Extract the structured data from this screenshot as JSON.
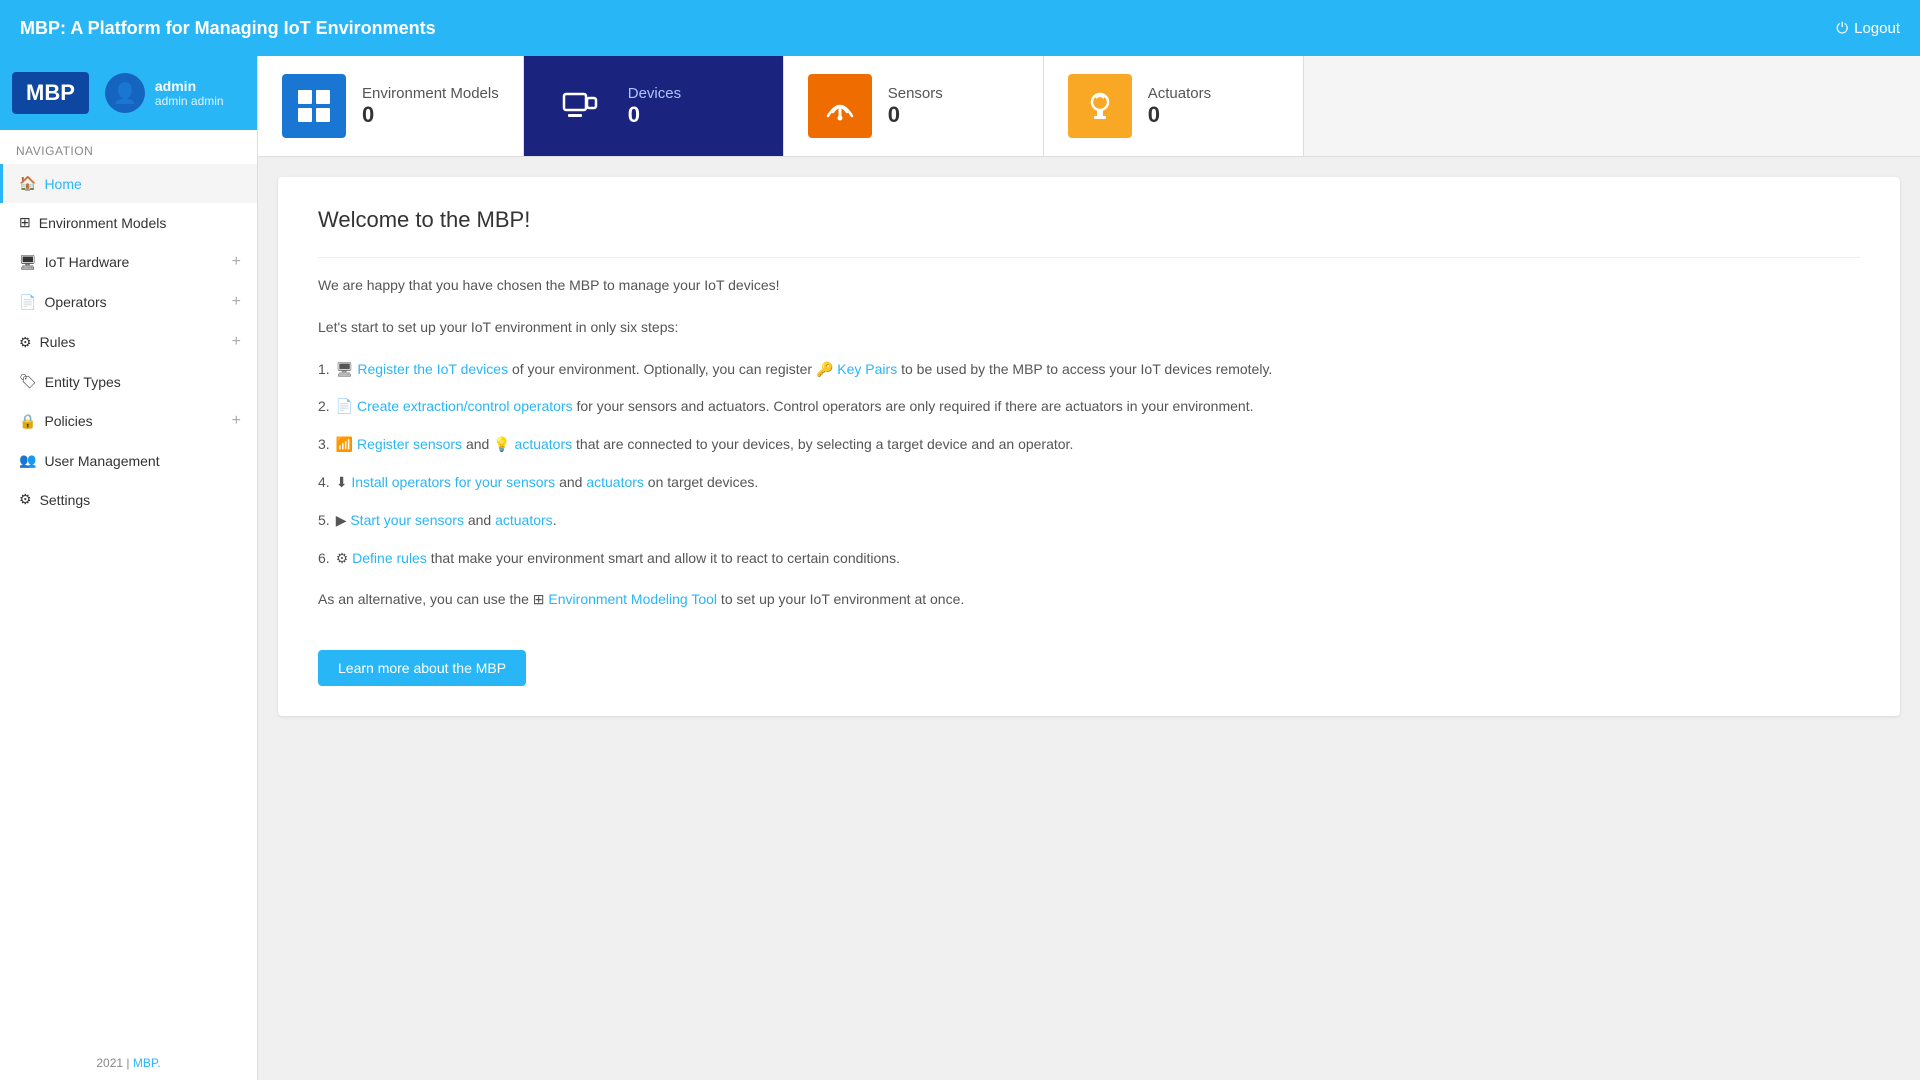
{
  "header": {
    "title": "MBP: A Platform for Managing IoT Environments",
    "logout_label": "Logout",
    "logout_icon": "⏻"
  },
  "sidebar": {
    "logo": "MBP",
    "profile": {
      "name": "admin",
      "fullname": "admin admin",
      "avatar_icon": "👤"
    },
    "nav_section": "Navigation",
    "items": [
      {
        "label": "Home",
        "active": true,
        "has_plus": false
      },
      {
        "label": "Environment Models",
        "active": false,
        "has_plus": false
      },
      {
        "label": "IoT Hardware",
        "active": false,
        "has_plus": true
      },
      {
        "label": "Operators",
        "active": false,
        "has_plus": true
      },
      {
        "label": "Rules",
        "active": false,
        "has_plus": true
      },
      {
        "label": "Entity Types",
        "active": false,
        "has_plus": false
      },
      {
        "label": "Policies",
        "active": false,
        "has_plus": true
      },
      {
        "label": "User Management",
        "active": false,
        "has_plus": false
      },
      {
        "label": "Settings",
        "active": false,
        "has_plus": false
      }
    ]
  },
  "stats": [
    {
      "label": "Environment Models",
      "value": "0",
      "color": "blue",
      "icon": "⊞"
    },
    {
      "label": "Devices",
      "value": "0",
      "color": "dark-blue",
      "icon": "🖥"
    },
    {
      "label": "Sensors",
      "value": "0",
      "color": "orange",
      "icon": "📶"
    },
    {
      "label": "Actuators",
      "value": "0",
      "color": "yellow",
      "icon": "💡"
    }
  ],
  "content": {
    "welcome_title": "Welcome to the MBP!",
    "intro_text": "We are happy that you have chosen the MBP to manage your IoT devices!",
    "steps_intro": "Let's start to set up your IoT environment in only six steps:",
    "steps": [
      {
        "number": "1.",
        "link1_text": "Register the IoT devices",
        "link1_icon": "🖥",
        "middle_text": " of your environment. Optionally, you can register ",
        "link2_text": "Key Pairs",
        "link2_icon": "🔑",
        "end_text": " to be used by the MBP to access your IoT devices remotely."
      },
      {
        "number": "2.",
        "link1_text": "Create extraction/control operators",
        "link1_icon": "📄",
        "middle_text": " for your sensors and actuators. Control operators are only required if there are actuators in your environment.",
        "link2_text": "",
        "link2_icon": "",
        "end_text": ""
      },
      {
        "number": "3.",
        "link1_text": "Register sensors",
        "link1_icon": "📶",
        "middle_text": " and ",
        "link2_text": "actuators",
        "link2_icon": "💡",
        "end_text": " that are connected to your devices, by selecting a target device and an operator."
      },
      {
        "number": "4.",
        "link1_text": "Install operators for your sensors",
        "link1_icon": "⬇",
        "middle_text": " and ",
        "link2_text": "actuators",
        "link2_icon": "",
        "end_text": " on target devices."
      },
      {
        "number": "5.",
        "link1_text": "Start your sensors",
        "link1_icon": "▶",
        "middle_text": " and ",
        "link2_text": "actuators",
        "link2_icon": "",
        "end_text": "."
      },
      {
        "number": "6.",
        "link1_text": "Define rules",
        "link1_icon": "⚙",
        "middle_text": " that make your environment smart and allow it to react to certain conditions.",
        "link2_text": "",
        "link2_icon": "",
        "end_text": ""
      }
    ],
    "alternative_text": "As an alternative, you can use the ",
    "env_tool_text": "Environment Modeling Tool",
    "env_tool_icon": "⊞",
    "alternative_end": " to set up your IoT environment at once.",
    "learn_btn": "Learn more about the MBP"
  },
  "footer": {
    "year": "2021",
    "link_text": "MBP."
  }
}
